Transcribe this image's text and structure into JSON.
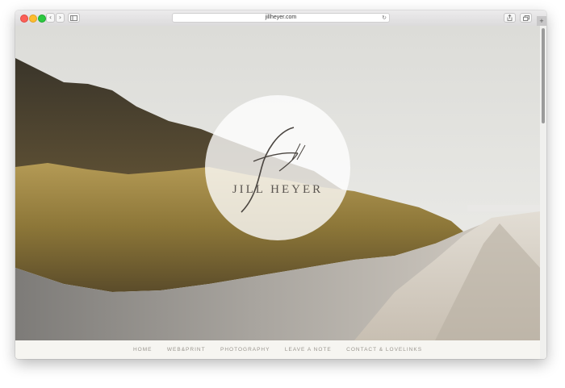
{
  "browser": {
    "url": "jillheyer.com",
    "icons": {
      "back": "chevron-left-icon",
      "forward": "chevron-right-icon",
      "sidebar": "sidebar-icon",
      "reload": "reload-icon",
      "share": "share-icon",
      "tabs": "tabs-icon",
      "new_tab": "plus-icon"
    }
  },
  "logo": {
    "name": "JILL HEYER"
  },
  "nav": {
    "items": [
      {
        "label": "HOME"
      },
      {
        "label": "WEB&PRINT"
      },
      {
        "label": "PHOTOGRAPHY"
      },
      {
        "label": "LEAVE A NOTE"
      },
      {
        "label": "CONTACT & LOVELINKS"
      }
    ]
  },
  "colors": {
    "close": "#fc5f57",
    "minimize": "#fdbc2e",
    "maximize": "#2bc840",
    "nav_text": "#9a968f"
  }
}
